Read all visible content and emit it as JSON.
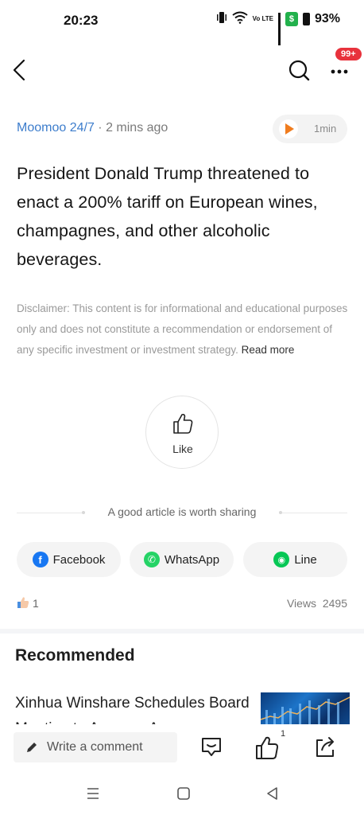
{
  "status_bar": {
    "time": "20:23",
    "battery": "93%",
    "volte": "Vo LTE",
    "wallet_glyph": "$"
  },
  "nav": {
    "badge": "99+"
  },
  "article": {
    "source": "Moomoo 24/7",
    "separator": " · ",
    "time_ago": "2 mins ago",
    "audio_length": "1min",
    "headline": "President Donald Trump threatened to enact a 200% tariff on European wines, champagnes, and other alcoholic beverages.",
    "disclaimer": "Disclaimer: This content is for informational and educational purposes only and does not constitute a recommendation or endorsement of any specific investment or investment strategy. ",
    "read_more": "Read more"
  },
  "like": {
    "label": "Like"
  },
  "share": {
    "title": "A good article is worth sharing",
    "buttons": [
      {
        "label": "Facebook",
        "icon": "facebook-icon",
        "color": "#1877f2",
        "glyph": "f"
      },
      {
        "label": "WhatsApp",
        "icon": "whatsapp-icon",
        "color": "#25d366",
        "glyph": "✆"
      },
      {
        "label": "Line",
        "icon": "line-icon",
        "color": "#06c755",
        "glyph": "◉"
      }
    ]
  },
  "stats": {
    "likes": "1",
    "views_label": "Views",
    "views_value": "2495"
  },
  "recommended": {
    "title": "Recommended",
    "items": [
      {
        "title": "Xinhua Winshare Schedules Board Meeting to Approve A"
      }
    ]
  },
  "bottom_bar": {
    "comment_placeholder": "Write a comment",
    "like_count": "1"
  },
  "colors": {
    "source_blue": "#3d7dcc",
    "audio_orange": "#f07c1e",
    "badge_red": "#e8323c"
  }
}
